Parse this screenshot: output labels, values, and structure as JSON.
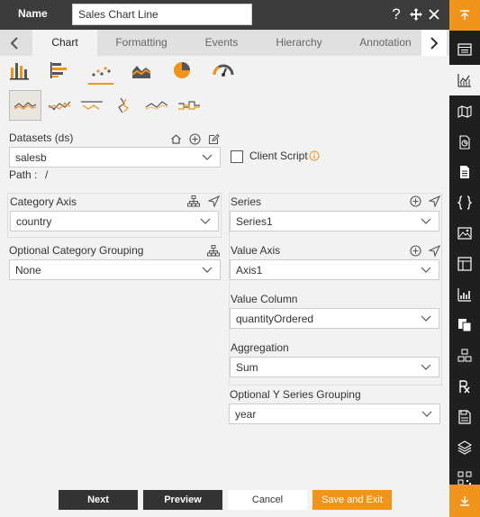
{
  "header": {
    "name_label": "Name",
    "name_value": "Sales Chart Line",
    "icons": [
      "help-icon",
      "move-icon",
      "close-icon"
    ]
  },
  "tabs": [
    {
      "label": "Chart",
      "active": true
    },
    {
      "label": "Formatting",
      "active": false
    },
    {
      "label": "Events",
      "active": false
    },
    {
      "label": "Hierarchy",
      "active": false
    },
    {
      "label": "Annotation",
      "active": false
    }
  ],
  "chart_types": [
    "bar-chart-icon",
    "horizontal-bar-icon",
    "scatter-icon",
    "area-chart-icon",
    "pie-chart-icon",
    "gauge-icon"
  ],
  "chart_subtypes": [
    "line-subtype-1",
    "line-subtype-2",
    "line-subtype-3",
    "line-subtype-4",
    "line-subtype-5",
    "line-subtype-6"
  ],
  "datasets": {
    "label": "Datasets (ds)",
    "value": "salesb",
    "path_label": "Path :",
    "path_value": "/"
  },
  "client_script": {
    "label": "Client Script",
    "checked": false
  },
  "category_axis": {
    "label": "Category Axis",
    "value": "country"
  },
  "optional_category_grouping": {
    "label": "Optional Category Grouping",
    "value": "None"
  },
  "series": {
    "label": "Series",
    "value": "Series1"
  },
  "value_axis": {
    "label": "Value Axis",
    "value": "Axis1"
  },
  "value_column": {
    "label": "Value Column",
    "value": "quantityOrdered"
  },
  "aggregation": {
    "label": "Aggregation",
    "value": "Sum"
  },
  "optional_y_series_grouping": {
    "label": "Optional Y Series Grouping",
    "value": "year"
  },
  "footer": {
    "next": "Next",
    "preview": "Preview",
    "cancel": "Cancel",
    "save_exit": "Save and Exit"
  },
  "colors": {
    "accent": "#f0941c",
    "header_bg": "#3c3c3c",
    "toolbar_bg": "#1f1f1f"
  },
  "right_toolbar": [
    "scroll-top-icon",
    "grid-panel-icon",
    "chart-icon",
    "map-icon",
    "report-icon",
    "document-icon",
    "code-icon",
    "image-icon",
    "layout-icon",
    "kpi-icon",
    "copy-icon",
    "cubes-icon",
    "rx-icon",
    "save-icon",
    "layers-icon",
    "qr-icon",
    "scroll-bottom-icon"
  ]
}
